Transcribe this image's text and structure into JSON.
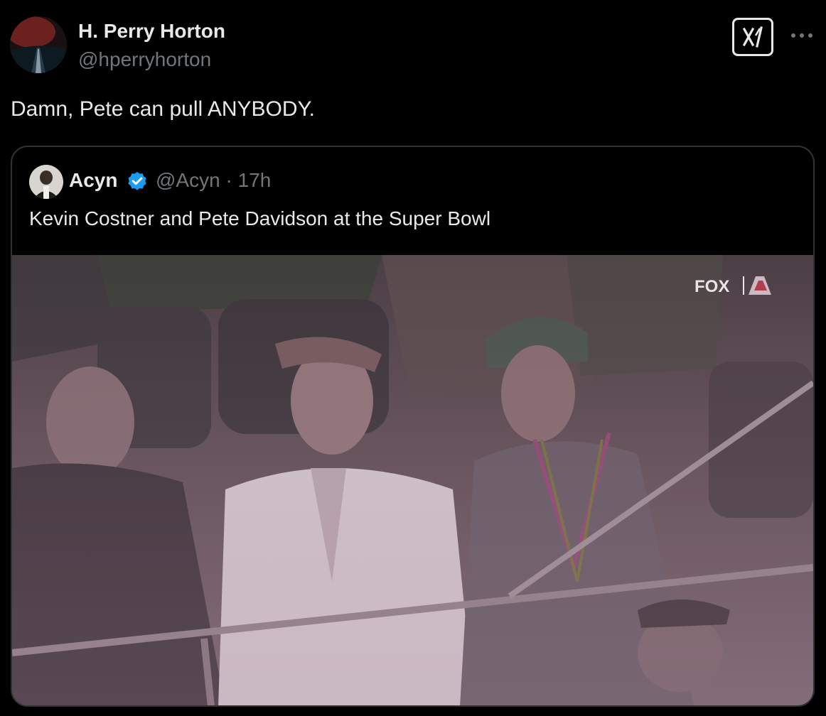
{
  "tweet": {
    "author_name": "H. Perry Horton",
    "author_handle": "@hperryhorton",
    "text": "Damn, Pete can pull ANYBODY."
  },
  "quote": {
    "author_name": "Acyn",
    "author_handle": "@Acyn",
    "separator": "·",
    "time": "17h",
    "text": "Kevin Costner and Pete Davidson at the Super Bowl",
    "verified": true
  },
  "media": {
    "broadcast_logo": "FOX"
  },
  "icons": {
    "grok": "grok-icon",
    "more": "more-dots-icon",
    "verified": "verified-badge-icon"
  },
  "colors": {
    "background": "#000000",
    "text_primary": "#e7e9ea",
    "text_secondary": "#71767b",
    "verified_blue": "#1d9bf0",
    "border": "#2f3336"
  }
}
